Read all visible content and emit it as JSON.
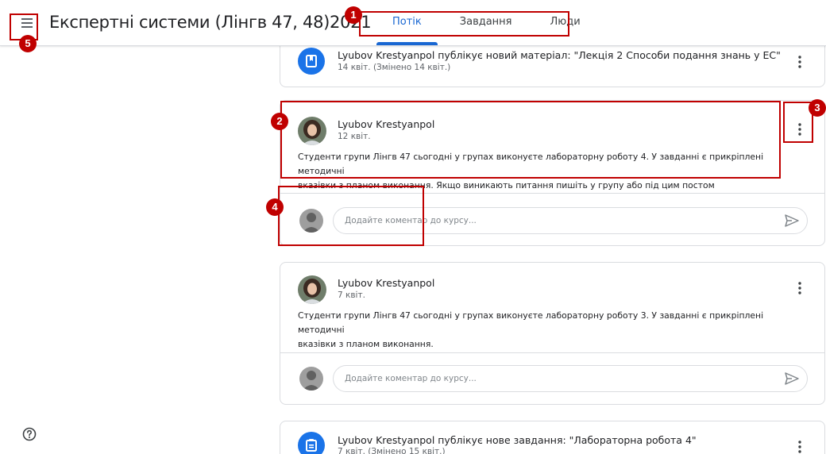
{
  "header": {
    "course_title": "Експертні системи (Лінгв 47, 48)2021",
    "tabs": [
      {
        "label": "Потік",
        "active": true
      },
      {
        "label": "Завдання",
        "active": false
      },
      {
        "label": "Люди",
        "active": false
      }
    ],
    "accent_color": "#1967d2"
  },
  "annotations": [
    "1",
    "2",
    "3",
    "4",
    "5"
  ],
  "stream": {
    "material": {
      "title": "Lyubov Krestyanpol публікує новий матеріал: \"Лекція 2 Способи подання знань у ЕС\"",
      "date": "14 квіт. (Змінено 14 квіт.)",
      "icon": "material-book-icon"
    },
    "posts": [
      {
        "author": "Lyubov Krestyanpol",
        "date": "12 квіт.",
        "text_line1": "Студенти групи Лінгв 47 сьогодні у групах виконуєте лабораторну роботу 4. У завданні є прикріплені методичні",
        "text_line2": "вказівки з  планом виконання. Якщо виникають питання пишіть у групу або під цим постом",
        "comment_placeholder": "Додайте коментар до курсу..."
      },
      {
        "author": "Lyubov Krestyanpol",
        "date": "7 квіт.",
        "text_line1": "Студенти групи Лінгв 47 сьогодні у групах виконуєте лабораторну роботу 3. У завданні є прикріплені методичні",
        "text_line2": "вказівки з  планом виконання.",
        "comment_placeholder": "Додайте коментар до курсу..."
      }
    ],
    "assignment": {
      "title": "Lyubov Krestyanpol публікує нове завдання: \"Лабораторна робота 4\"",
      "date": "7 квіт. (Змінено 15 квіт.)",
      "icon": "assignment-icon"
    }
  }
}
